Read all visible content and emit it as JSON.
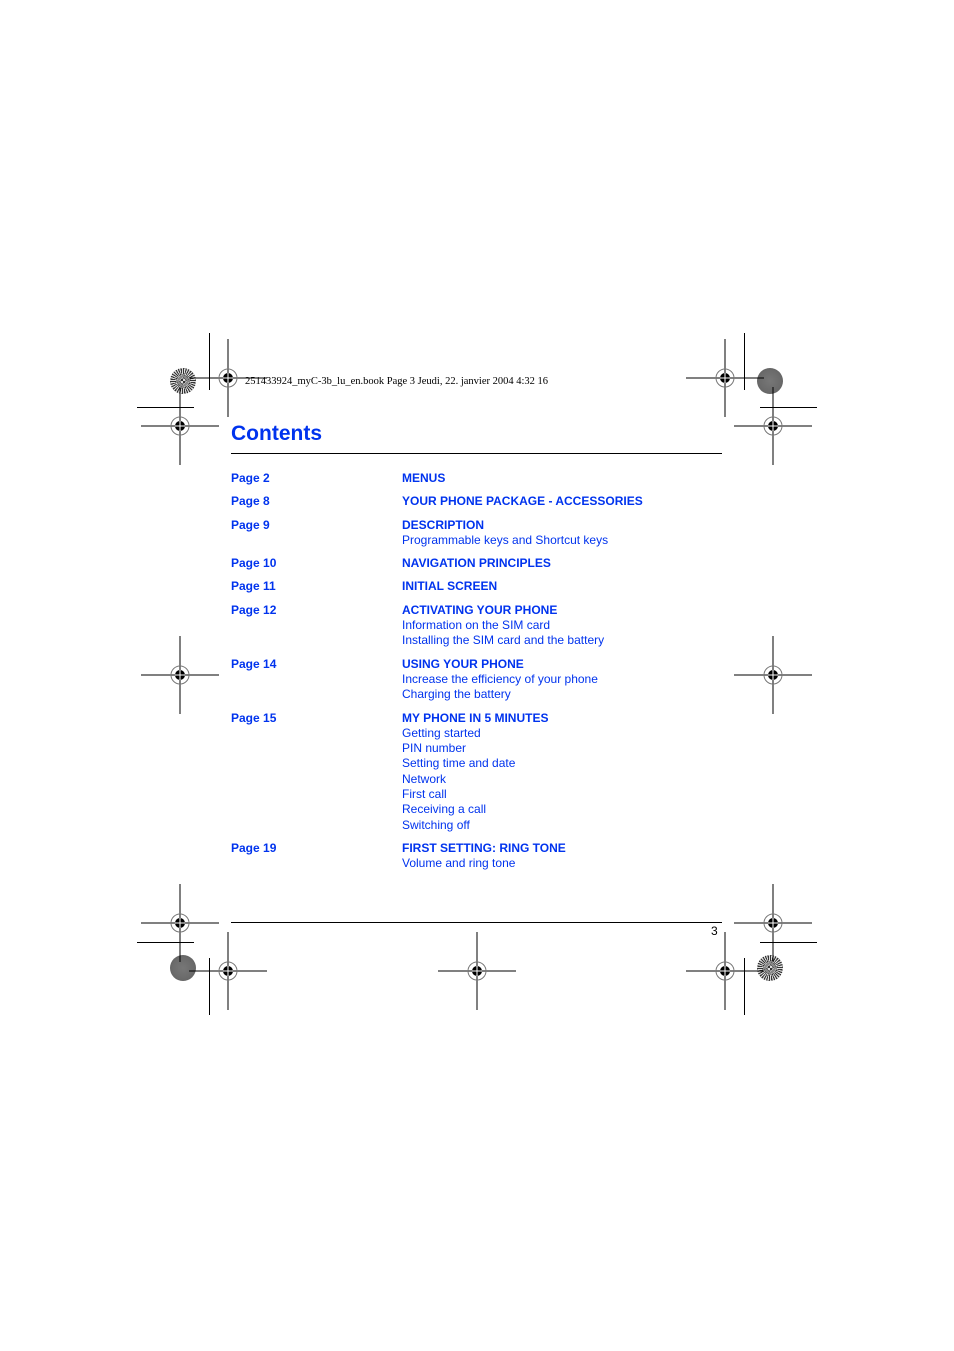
{
  "slug": "251433924_myC-3b_lu_en.book  Page 3  Jeudi, 22. janvier 2004  4:32 16",
  "title": "Contents",
  "page_number": "3",
  "colors": {
    "accent": "#0033ee",
    "text": "#000000"
  },
  "toc": [
    {
      "page": "Page 2",
      "heading": "MENUS",
      "subs": []
    },
    {
      "page": "Page 8",
      "heading": "YOUR PHONE PACKAGE - ACCESSORIES",
      "subs": []
    },
    {
      "page": "Page 9",
      "heading": "DESCRIPTION",
      "subs": [
        "Programmable keys and  Shortcut keys"
      ]
    },
    {
      "page": "Page 10",
      "heading": "NAVIGATION PRINCIPLES",
      "subs": []
    },
    {
      "page": "Page 11",
      "heading": "INITIAL SCREEN",
      "subs": []
    },
    {
      "page": "Page 12",
      "heading": "ACTIVATING YOUR PHONE",
      "subs": [
        "Information on the SIM card",
        "Installing the SIM card and the battery"
      ]
    },
    {
      "page": "Page 14",
      "heading": "USING YOUR PHONE",
      "subs": [
        "Increase the efficiency of your phone",
        "Charging the battery"
      ]
    },
    {
      "page": "Page 15",
      "heading": "MY PHONE IN 5 MINUTES",
      "subs": [
        "Getting started",
        "PIN number",
        "Setting time and date",
        "Network",
        "First call",
        "Receiving a call",
        "Switching off"
      ]
    },
    {
      "page": "Page 19",
      "heading": "FIRST SETTING: RING TONE",
      "subs": [
        "Volume and ring tone"
      ]
    }
  ]
}
